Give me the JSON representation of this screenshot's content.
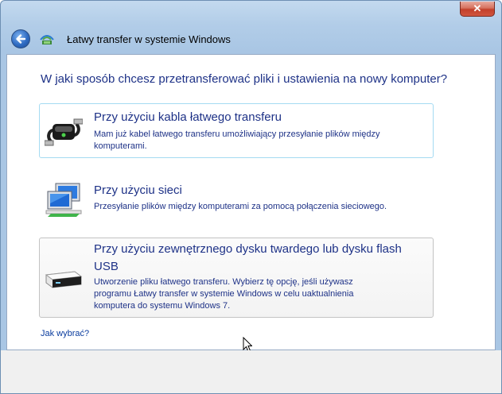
{
  "window": {
    "title": "Łatwy transfer w systemie Windows",
    "close_label": "✕"
  },
  "main": {
    "question": "W jaki sposób chcesz przetransferować pliki i ustawienia na nowy komputer?",
    "options": [
      {
        "title": "Przy użyciu kabla łatwego transferu",
        "description": "Mam już kabel łatwego transferu umożliwiający przesyłanie plików między komputerami.",
        "icon": "usb-cable-icon"
      },
      {
        "title": "Przy użyciu sieci",
        "description": "Przesyłanie plików między komputerami za pomocą połączenia sieciowego.",
        "icon": "network-icon"
      },
      {
        "title": "Przy użyciu zewnętrznego dysku twardego lub dysku flash USB",
        "description": "Utworzenie pliku łatwego transferu. Wybierz tę opcję, jeśli używasz programu Łatwy transfer w systemie Windows w celu uaktualnienia komputera do systemu Windows 7.",
        "icon": "external-drive-icon"
      }
    ],
    "help_link": "Jak wybrać?"
  },
  "colors": {
    "text_blue": "#1e3287",
    "link_blue": "#0a3c9e",
    "frame": "#a9c6e4",
    "focus_border": "#a4dbf2"
  }
}
